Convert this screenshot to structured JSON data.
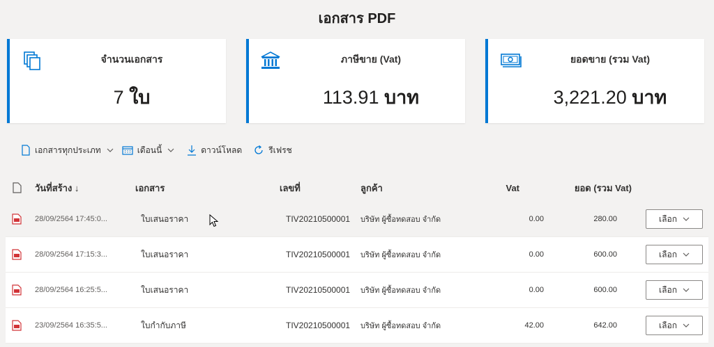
{
  "page": {
    "title": "เอกสาร PDF"
  },
  "cards": [
    {
      "icon": "documents-icon",
      "label": "จำนวนเอกสาร",
      "value": "7",
      "unit": "ใบ"
    },
    {
      "icon": "bank-icon",
      "label": "ภาษีขาย (Vat)",
      "value": "113.91",
      "unit": "บาท"
    },
    {
      "icon": "money-icon",
      "label": "ยอดขาย (รวม Vat)",
      "value": "3,221.20",
      "unit": "บาท"
    }
  ],
  "toolbar": {
    "doc_type": "เอกสารทุกประเภท",
    "period": "เดือนนี้",
    "download": "ดาวน์โหลด",
    "refresh": "รีเฟรช"
  },
  "table": {
    "headers": {
      "date": "วันที่สร้าง ↓",
      "document": "เอกสาร",
      "number": "เลขที่",
      "customer": "ลูกค้า",
      "vat": "Vat",
      "total": "ยอด (รวม Vat)"
    },
    "rows": [
      {
        "date": "28/09/2564 17:45:0...",
        "document": "ใบเสนอราคา",
        "number": "TIV20210500001",
        "customer": "บริษัท ผู้ซื้อทดสอบ จำกัด",
        "vat": "0.00",
        "total": "280.00",
        "action": "เลือก"
      },
      {
        "date": "28/09/2564 17:15:3...",
        "document": "ใบเสนอราคา",
        "number": "TIV20210500001",
        "customer": "บริษัท ผู้ซื้อทดสอบ จำกัด",
        "vat": "0.00",
        "total": "600.00",
        "action": "เลือก"
      },
      {
        "date": "28/09/2564 16:25:5...",
        "document": "ใบเสนอราคา",
        "number": "TIV20210500001",
        "customer": "บริษัท ผู้ซื้อทดสอบ จำกัด",
        "vat": "0.00",
        "total": "600.00",
        "action": "เลือก"
      },
      {
        "date": "23/09/2564 16:35:5...",
        "document": "ใบกำกับภาษี",
        "number": "TIV20210500001",
        "customer": "บริษัท ผู้ซื้อทดสอบ จำกัด",
        "vat": "42.00",
        "total": "642.00",
        "action": "เลือก"
      }
    ]
  },
  "colors": {
    "accent": "#0078d4",
    "pdf_red": "#d13438",
    "background": "#f3f2f1"
  }
}
